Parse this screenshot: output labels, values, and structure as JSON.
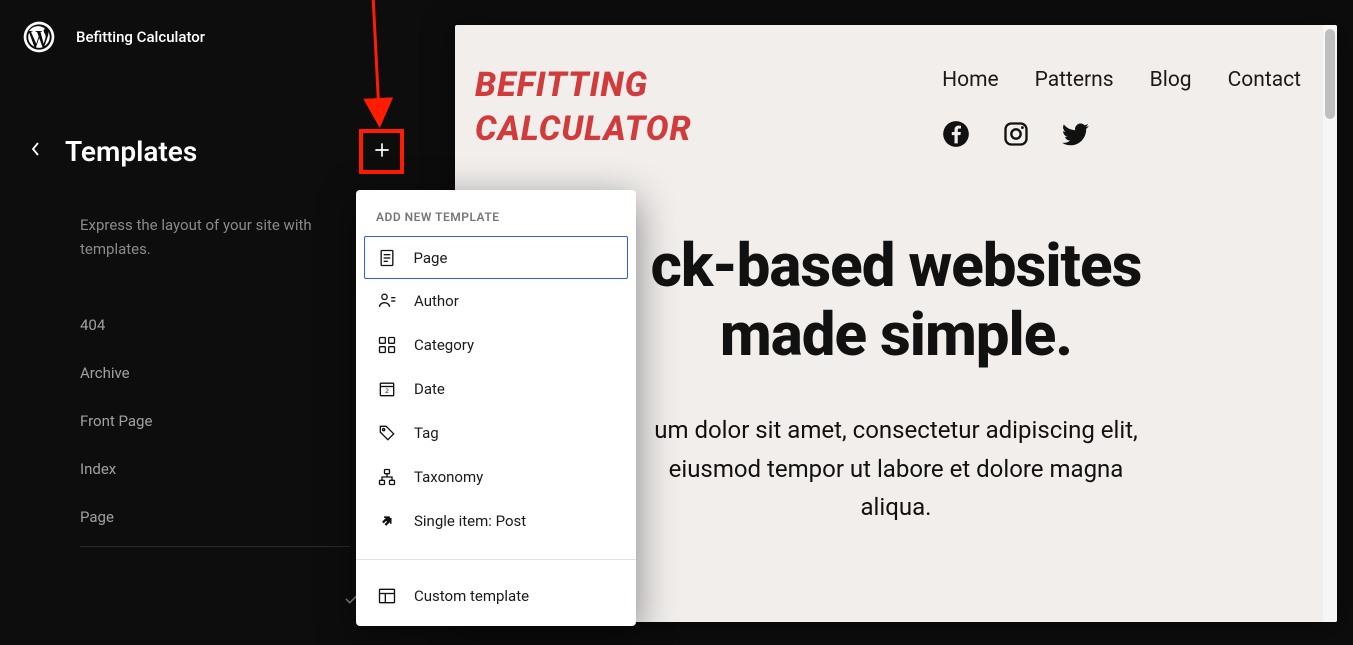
{
  "topbar": {
    "site": "Befitting Calculator"
  },
  "sidebar": {
    "title": "Templates",
    "description": "Express the layout of your site with templates.",
    "items": [
      {
        "label": "404"
      },
      {
        "label": "Archive"
      },
      {
        "label": "Front Page"
      },
      {
        "label": "Index"
      },
      {
        "label": "Page"
      }
    ]
  },
  "popover": {
    "heading": "ADD NEW TEMPLATE",
    "items": [
      {
        "label": "Page",
        "icon": "page-icon"
      },
      {
        "label": "Author",
        "icon": "author-icon"
      },
      {
        "label": "Category",
        "icon": "category-icon"
      },
      {
        "label": "Date",
        "icon": "date-icon"
      },
      {
        "label": "Tag",
        "icon": "tag-icon"
      },
      {
        "label": "Taxonomy",
        "icon": "taxonomy-icon"
      },
      {
        "label": "Single item: Post",
        "icon": "single-post-icon"
      }
    ],
    "custom": {
      "label": "Custom template",
      "icon": "custom-template-icon"
    }
  },
  "preview": {
    "siteTitle1": "BEFITTING",
    "siteTitle2": "CALCULATOR",
    "nav": [
      "Home",
      "Patterns",
      "Blog",
      "Contact"
    ],
    "hero": {
      "line1": "ck-based websites",
      "line2": "made simple.",
      "p1": "um dolor sit amet, consectetur adipiscing elit,",
      "p2": "eiusmod tempor ut labore et dolore magna",
      "p3": "aliqua."
    }
  }
}
